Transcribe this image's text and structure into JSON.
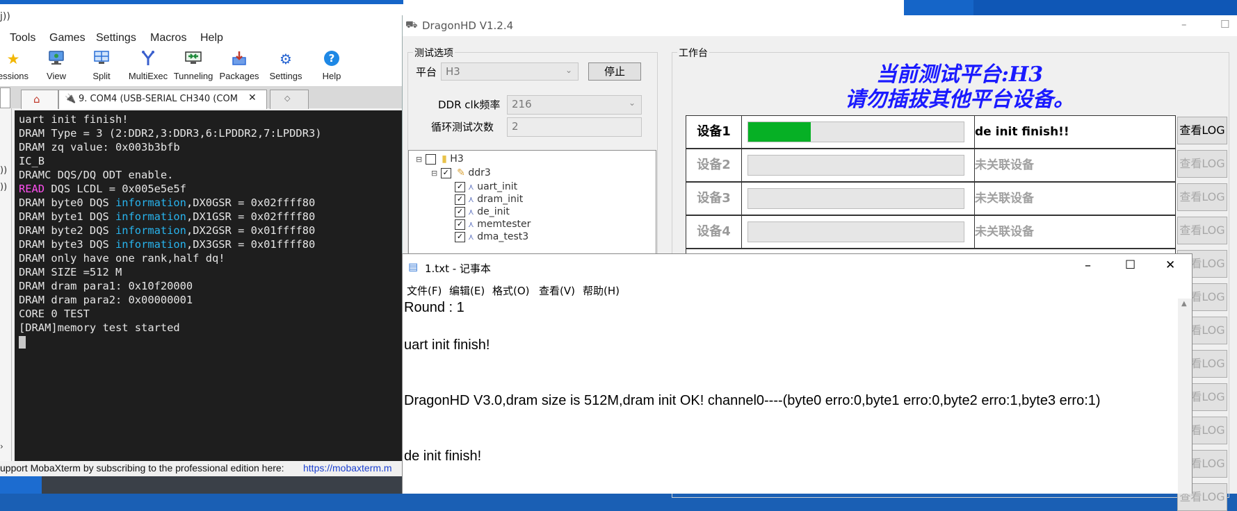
{
  "desktop": {
    "bg_color": "#1a5fb4"
  },
  "moba": {
    "title_fragment": "j))",
    "menu": [
      "Tools",
      "Games",
      "Settings",
      "Macros",
      "Help"
    ],
    "toolbar": [
      {
        "label": "essions",
        "icon": "star-icon",
        "color": "#f2b705"
      },
      {
        "label": "View",
        "icon": "monitor-icon",
        "color": "#3a7bd5"
      },
      {
        "label": "Split",
        "icon": "split-screen-icon",
        "color": "#2a6fd6"
      },
      {
        "label": "MultiExec",
        "icon": "fork-icon",
        "color": "#3a5fcd"
      },
      {
        "label": "Tunneling",
        "icon": "tunnel-icon",
        "color": "#1d8a3a"
      },
      {
        "label": "Packages",
        "icon": "packages-icon",
        "color": "#2f6bd8"
      },
      {
        "label": "Settings",
        "icon": "gears-icon",
        "color": "#2563d1"
      },
      {
        "label": "Help",
        "icon": "help-icon",
        "color": "#1e88e5"
      }
    ],
    "tab_label": "9. COM4  (USB-SERIAL CH340 (COM",
    "left_strip_fragments": [
      "))",
      "))"
    ],
    "terminal_lines": [
      [
        {
          "t": "uart init finish!"
        }
      ],
      [
        {
          "t": "DRAM Type = 3 (2:DDR2,3:DDR3,6:LPDDR2,7:LPDDR3)"
        }
      ],
      [
        {
          "t": "DRAM zq value: 0x003b3bfb"
        }
      ],
      [
        {
          "t": "IC_B"
        }
      ],
      [
        {
          "t": "DRAMC DQS/DQ ODT enable."
        }
      ],
      [
        {
          "t": "READ",
          "c": "kw-read"
        },
        {
          "t": " DQS LCDL = 0x005e5e5f"
        }
      ],
      [
        {
          "t": "DRAM byte0 DQS "
        },
        {
          "t": "information",
          "c": "kw-info"
        },
        {
          "t": ",DX0GSR = 0x02ffff80"
        }
      ],
      [
        {
          "t": "DRAM byte1 DQS "
        },
        {
          "t": "information",
          "c": "kw-info"
        },
        {
          "t": ",DX1GSR = 0x02ffff80"
        }
      ],
      [
        {
          "t": "DRAM byte2 DQS "
        },
        {
          "t": "information",
          "c": "kw-info"
        },
        {
          "t": ",DX2GSR = 0x01ffff80"
        }
      ],
      [
        {
          "t": "DRAM byte3 DQS "
        },
        {
          "t": "information",
          "c": "kw-info"
        },
        {
          "t": ",DX3GSR = 0x01ffff80"
        }
      ],
      [
        {
          "t": "DRAM only have one rank,half dq!"
        }
      ],
      [
        {
          "t": "DRAM SIZE =512 M"
        }
      ],
      [
        {
          "t": "DRAM dram para1: 0x10f20000"
        }
      ],
      [
        {
          "t": "DRAM dram para2: 0x00000001"
        }
      ],
      [
        {
          "t": "CORE 0 TEST"
        }
      ],
      [
        {
          "t": "[DRAM]memory test started"
        }
      ]
    ],
    "status_text": "upport MobaXterm by subscribing to the professional edition here:  ",
    "status_link": "https://mobaxterm.m"
  },
  "dragon": {
    "title": "DragonHD V1.2.4",
    "options_group": "测试选项",
    "platform_label": "平台",
    "platform_value": "H3",
    "stop_button": "停止",
    "ddr_clk_label": "DDR clk频率",
    "ddr_clk_value": "216",
    "loop_label": "循环测试次数",
    "loop_value": "2",
    "tree": {
      "root": "H3",
      "child": "ddr3",
      "leaves": [
        "uart_init",
        "dram_init",
        "de_init",
        "memtester",
        "dma_test3"
      ]
    },
    "workbench_group": "工作台",
    "headline1": "当前测试平台:H3",
    "headline2": "请勿插拔其他平台设备。",
    "devices": [
      {
        "name": "设备1",
        "progress": 0.29,
        "status": "de init finish!!",
        "log": "查看LOG",
        "active": true
      },
      {
        "name": "设备2",
        "progress": 0,
        "status": "未关联设备",
        "log": "查看LOG",
        "active": false
      },
      {
        "name": "设备3",
        "progress": 0,
        "status": "未关联设备",
        "log": "查看LOG",
        "active": false
      },
      {
        "name": "设备4",
        "progress": 0,
        "status": "未关联设备",
        "log": "查看LOG",
        "active": false
      }
    ],
    "extra_log_buttons": [
      "查看LOG",
      "查看LOG",
      "查看LOG",
      "查看LOG",
      "查看LOG",
      "查看LOG",
      "查看LOG",
      "查看LOG"
    ],
    "progress_color": "#06b025"
  },
  "notepad": {
    "title": "1.txt - 记事本",
    "menu": [
      "文件(F)",
      "编辑(E)",
      "格式(O)",
      "查看(V)",
      "帮助(H)"
    ],
    "lines": [
      "Round : 1",
      "uart init finish!",
      "DragonHD V3.0,dram size is 512M,dram init OK! channel0----(byte0 erro:0,byte1 erro:0,byte2 erro:1,byte3 erro:1)",
      "de init finish!"
    ]
  }
}
